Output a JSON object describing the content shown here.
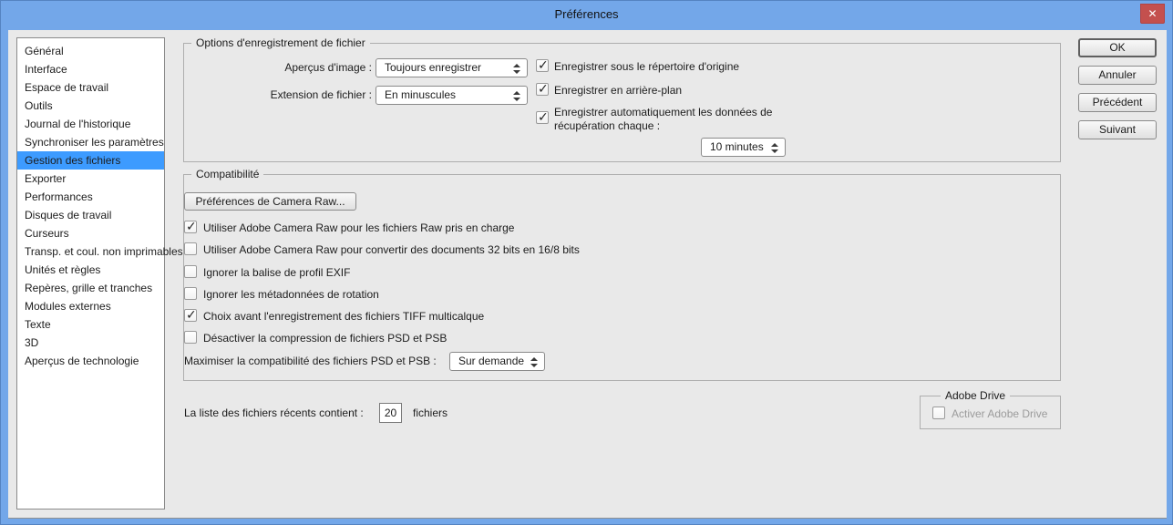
{
  "window": {
    "title": "Préférences",
    "close_icon": "✕"
  },
  "colors": {
    "frame_blue": "#73a7e9",
    "titlebar_blue": "#73a7e9",
    "selection_blue": "#3d9bff",
    "close_red": "#c4504e",
    "dialog_bg": "#e9e9e9"
  },
  "sidebar": {
    "items": [
      {
        "label": "Général",
        "selected": false
      },
      {
        "label": "Interface",
        "selected": false
      },
      {
        "label": "Espace de travail",
        "selected": false
      },
      {
        "label": "Outils",
        "selected": false
      },
      {
        "label": "Journal de l'historique",
        "selected": false
      },
      {
        "label": "Synchroniser les paramètres",
        "selected": false
      },
      {
        "label": "Gestion des fichiers",
        "selected": true
      },
      {
        "label": "Exporter",
        "selected": false
      },
      {
        "label": "Performances",
        "selected": false
      },
      {
        "label": "Disques de travail",
        "selected": false
      },
      {
        "label": "Curseurs",
        "selected": false
      },
      {
        "label": "Transp. et coul. non imprimables",
        "selected": false
      },
      {
        "label": "Unités et règles",
        "selected": false
      },
      {
        "label": "Repères, grille et tranches",
        "selected": false
      },
      {
        "label": "Modules externes",
        "selected": false
      },
      {
        "label": "Texte",
        "selected": false
      },
      {
        "label": "3D",
        "selected": false
      },
      {
        "label": "Aperçus de technologie",
        "selected": false
      }
    ]
  },
  "file_saving": {
    "legend": "Options d'enregistrement de fichier",
    "image_previews_label": "Aperçus d'image :",
    "image_previews_value": "Toujours enregistrer",
    "file_extension_label": "Extension de fichier :",
    "file_extension_value": "En minuscules",
    "checkboxes": [
      {
        "label": "Enregistrer sous le répertoire d'origine",
        "checked": true
      },
      {
        "label": "Enregistrer en arrière-plan",
        "checked": true
      },
      {
        "label": "Enregistrer automatiquement les données de récupération chaque :",
        "checked": true
      }
    ],
    "autosave_interval_value": "10 minutes"
  },
  "compatibility": {
    "legend": "Compatibilité",
    "camera_raw_button": "Préférences de Camera Raw...",
    "checkboxes": [
      {
        "label": "Utiliser Adobe Camera Raw pour les fichiers Raw pris en charge",
        "checked": true
      },
      {
        "label": "Utiliser Adobe Camera Raw pour convertir des documents 32 bits en 16/8 bits",
        "checked": false
      },
      {
        "label": "Ignorer la balise de profil EXIF",
        "checked": false
      },
      {
        "label": "Ignorer les métadonnées de rotation",
        "checked": false
      },
      {
        "label": "Choix avant l'enregistrement des fichiers TIFF multicalque",
        "checked": true
      },
      {
        "label": "Désactiver la compression de fichiers PSD et PSB",
        "checked": false
      }
    ],
    "maximize_label": "Maximiser la compatibilité des fichiers PSD et PSB :",
    "maximize_value": "Sur demande"
  },
  "recent_files": {
    "label": "La liste des fichiers récents contient :",
    "value": "20",
    "suffix": "fichiers"
  },
  "adobe_drive": {
    "legend": "Adobe Drive",
    "checkbox_label": "Activer Adobe Drive",
    "checked": false,
    "disabled": true
  },
  "action_buttons": [
    "OK",
    "Annuler",
    "Précédent",
    "Suivant"
  ]
}
